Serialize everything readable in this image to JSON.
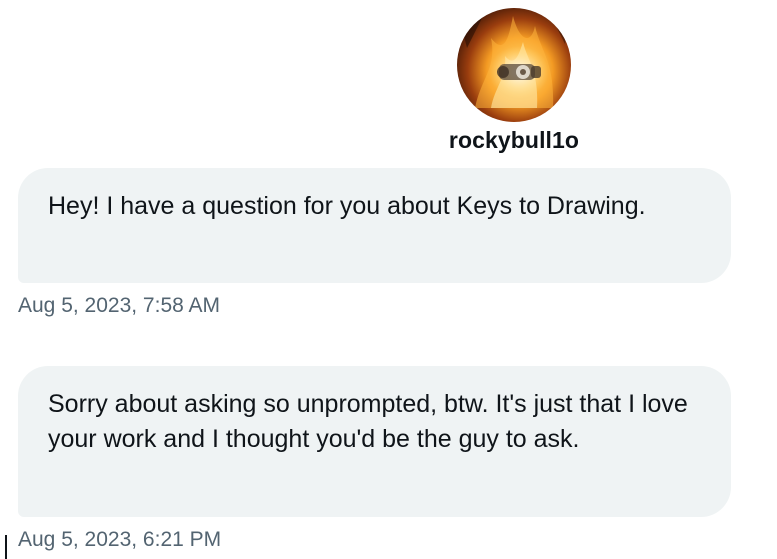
{
  "contact": {
    "avatar_icon": "flame-avatar-icon",
    "username": "rockybull1o"
  },
  "messages": [
    {
      "text": "Hey! I have a question for you about Keys to Drawing.",
      "timestamp": "Aug 5, 2023, 7:58 AM"
    },
    {
      "text": "Sorry about asking so unprompted, btw. It's just that I love your work and I thought you'd be the guy to ask.",
      "timestamp": "Aug 5, 2023, 6:21 PM"
    }
  ],
  "colors": {
    "bubble_background": "#eff3f4",
    "text_primary": "#0f1419",
    "text_secondary": "#536471"
  }
}
